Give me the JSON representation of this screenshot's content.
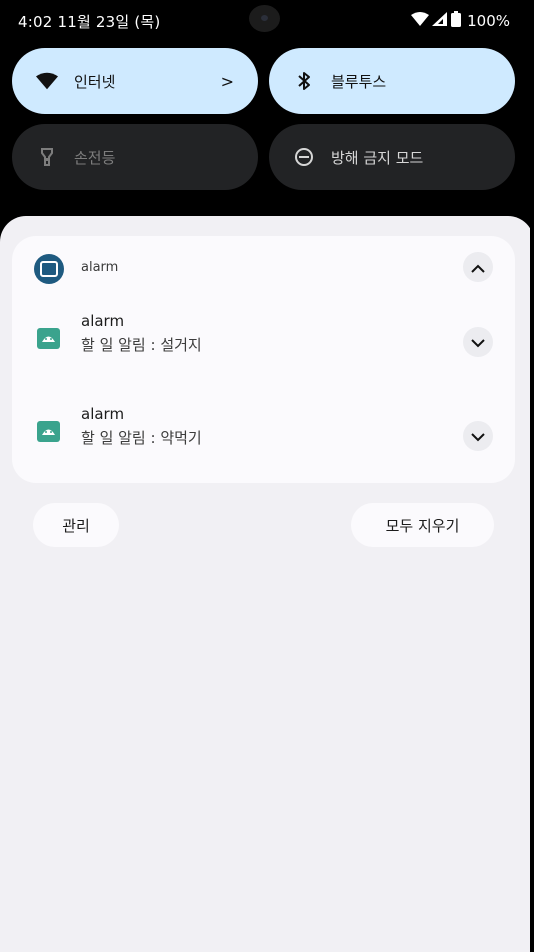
{
  "status_bar": {
    "time_date": "4:02  11월 23일 (목)",
    "battery": "100%"
  },
  "quick_settings": {
    "tiles": [
      {
        "label": "인터넷",
        "icon": "wifi-icon",
        "chevron": ">",
        "active": true
      },
      {
        "label": "블루투스",
        "icon": "bluetooth-icon",
        "active": true
      },
      {
        "label": "손전등",
        "icon": "flashlight-icon",
        "active": false
      },
      {
        "label": "방해 금지 모드",
        "icon": "do-not-disturb-icon",
        "active": false
      }
    ]
  },
  "notification_group": {
    "app_name": "alarm",
    "icon": "app-icon",
    "notifications": [
      {
        "title": "alarm",
        "text": "할 일 알림 : 설거지",
        "icon": "android-icon"
      },
      {
        "title": "alarm",
        "text": "할 일 알림 : 약먹기",
        "icon": "android-icon"
      }
    ]
  },
  "footer": {
    "manage_label": "관리",
    "clear_all_label": "모두 지우기"
  },
  "colors": {
    "tile_active": "#cfeaff",
    "tile_inactive": "#222325",
    "panel": "#f1f0f4",
    "card": "#fbfafd",
    "app_icon": "#1e5a80",
    "notif_icon": "#3aa38d"
  }
}
